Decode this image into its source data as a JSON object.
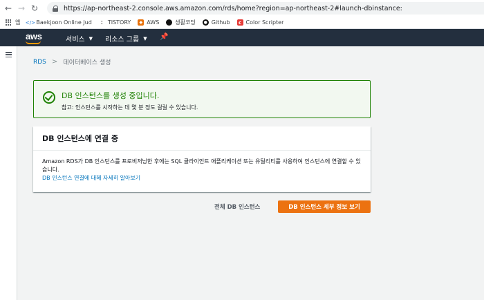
{
  "browser": {
    "url": "https://ap-northeast-2.console.aws.amazon.com/rds/home?region=ap-northeast-2#launch-dbinstance:",
    "bookmarks": [
      {
        "label": "앱",
        "icon": "apps-grid-icon"
      },
      {
        "label": "Baekjoon Online Jud",
        "icon": "code-icon"
      },
      {
        "label": "TISTORY",
        "icon": "tistory-icon"
      },
      {
        "label": "AWS",
        "icon": "aws-cube-icon"
      },
      {
        "label": "생활코딩",
        "icon": "dot-icon"
      },
      {
        "label": "Github",
        "icon": "github-icon"
      },
      {
        "label": "Color Scripter",
        "icon": "color-scripter-icon"
      }
    ]
  },
  "aws_header": {
    "logo": "aws",
    "services_label": "서비스",
    "resource_groups_label": "리소스 그룹",
    "pin_icon": "pin-icon"
  },
  "breadcrumb": {
    "root": "RDS",
    "current": "데이터베이스 생성"
  },
  "banner": {
    "title": "DB 인스턴스를 생성 중입니다.",
    "text": "참고: 인스턴스를 시작하는 데 몇 분 정도 걸릴 수 있습니다.",
    "color": "#1d8102"
  },
  "card": {
    "title": "DB 인스턴스에 연결 중",
    "body": "Amazon RDS가 DB 인스턴스를 프로비저닝한 후에는 SQL 클라이언트 애플리케이션 또는 유틸리티를 사용하여 인스턴스에 연결할 수 있습니다.",
    "link": "DB 인스턴스 연결에 대해 자세히 알아보기"
  },
  "actions": {
    "all_instances": "전체 DB 인스턴스",
    "view_details": "DB 인스턴스 세부 정보 보기",
    "accent": "#ec7211"
  }
}
